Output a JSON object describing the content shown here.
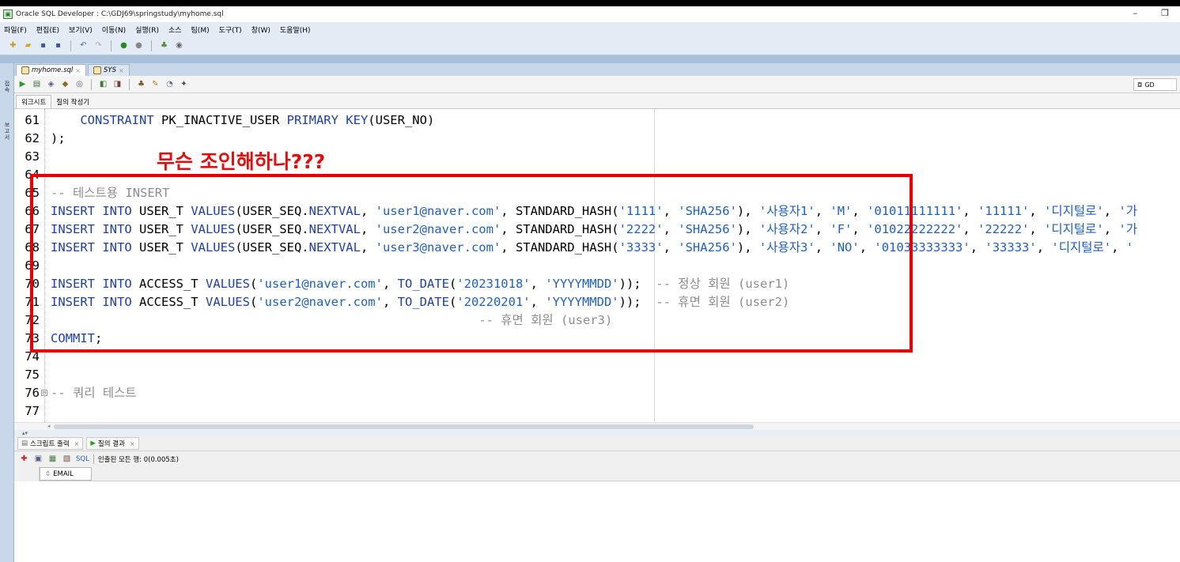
{
  "window": {
    "title": "Oracle SQL Developer : C:\\GDJ69\\springstudy\\myhome.sql",
    "minimize": "–",
    "restore": "❐"
  },
  "menu": [
    "파일(F)",
    "편집(E)",
    "보기(V)",
    "이동(N)",
    "실행(R)",
    "소스",
    "팀(M)",
    "도구(T)",
    "창(W)",
    "도움말(H)"
  ],
  "left_strip": {
    "tab1": "접속",
    "tab2": "보고서"
  },
  "doc_tabs": [
    {
      "label": "myhome.sql",
      "active": true
    },
    {
      "label": "SYS",
      "active": false
    }
  ],
  "editor_toolbar": {
    "connection": "GD"
  },
  "sub_tabs": [
    "워크시트",
    "질의 작성기"
  ],
  "code_lines": [
    {
      "num": "61",
      "segments": [
        {
          "t": "    ",
          "c": ""
        },
        {
          "t": "CONSTRAINT",
          "c": "kw"
        },
        {
          "t": " PK_INACTIVE_USER ",
          "c": ""
        },
        {
          "t": "PRIMARY KEY",
          "c": "kw"
        },
        {
          "t": "(USER_NO)",
          "c": ""
        }
      ]
    },
    {
      "num": "62",
      "segments": [
        {
          "t": ");",
          "c": ""
        }
      ]
    },
    {
      "num": "63",
      "segments": []
    },
    {
      "num": "64",
      "segments": []
    },
    {
      "num": "65",
      "segments": [
        {
          "t": "-- 테스트용 INSERT",
          "c": "cm"
        }
      ]
    },
    {
      "num": "66",
      "segments": [
        {
          "t": "INSERT INTO",
          "c": "kw"
        },
        {
          "t": " USER_T ",
          "c": ""
        },
        {
          "t": "VALUES",
          "c": "kw"
        },
        {
          "t": "(USER_SEQ.",
          "c": ""
        },
        {
          "t": "NEXTVAL",
          "c": "kw"
        },
        {
          "t": ", ",
          "c": ""
        },
        {
          "t": "'user1@naver.com'",
          "c": "str"
        },
        {
          "t": ", STANDARD_HASH(",
          "c": ""
        },
        {
          "t": "'1111'",
          "c": "str"
        },
        {
          "t": ", ",
          "c": ""
        },
        {
          "t": "'SHA256'",
          "c": "str"
        },
        {
          "t": "), ",
          "c": ""
        },
        {
          "t": "'사용자1'",
          "c": "str"
        },
        {
          "t": ", ",
          "c": ""
        },
        {
          "t": "'M'",
          "c": "str"
        },
        {
          "t": ", ",
          "c": ""
        },
        {
          "t": "'01011111111'",
          "c": "str"
        },
        {
          "t": ", ",
          "c": ""
        },
        {
          "t": "'11111'",
          "c": "str"
        },
        {
          "t": ", ",
          "c": ""
        },
        {
          "t": "'디지털로'",
          "c": "str"
        },
        {
          "t": ", ",
          "c": ""
        },
        {
          "t": "'가",
          "c": "str"
        }
      ]
    },
    {
      "num": "67",
      "segments": [
        {
          "t": "INSERT INTO",
          "c": "kw"
        },
        {
          "t": " USER_T ",
          "c": ""
        },
        {
          "t": "VALUES",
          "c": "kw"
        },
        {
          "t": "(USER_SEQ.",
          "c": ""
        },
        {
          "t": "NEXTVAL",
          "c": "kw"
        },
        {
          "t": ", ",
          "c": ""
        },
        {
          "t": "'user2@naver.com'",
          "c": "str"
        },
        {
          "t": ", STANDARD_HASH(",
          "c": ""
        },
        {
          "t": "'2222'",
          "c": "str"
        },
        {
          "t": ", ",
          "c": ""
        },
        {
          "t": "'SHA256'",
          "c": "str"
        },
        {
          "t": "), ",
          "c": ""
        },
        {
          "t": "'사용자2'",
          "c": "str"
        },
        {
          "t": ", ",
          "c": ""
        },
        {
          "t": "'F'",
          "c": "str"
        },
        {
          "t": ", ",
          "c": ""
        },
        {
          "t": "'01022222222'",
          "c": "str"
        },
        {
          "t": ", ",
          "c": ""
        },
        {
          "t": "'22222'",
          "c": "str"
        },
        {
          "t": ", ",
          "c": ""
        },
        {
          "t": "'디지털로'",
          "c": "str"
        },
        {
          "t": ", ",
          "c": ""
        },
        {
          "t": "'가",
          "c": "str"
        }
      ]
    },
    {
      "num": "68",
      "segments": [
        {
          "t": "INSERT INTO",
          "c": "kw"
        },
        {
          "t": " USER_T ",
          "c": ""
        },
        {
          "t": "VALUES",
          "c": "kw"
        },
        {
          "t": "(USER_SEQ.",
          "c": ""
        },
        {
          "t": "NEXTVAL",
          "c": "kw"
        },
        {
          "t": ", ",
          "c": ""
        },
        {
          "t": "'user3@naver.com'",
          "c": "str"
        },
        {
          "t": ", STANDARD_HASH(",
          "c": ""
        },
        {
          "t": "'3333'",
          "c": "str"
        },
        {
          "t": ", ",
          "c": ""
        },
        {
          "t": "'SHA256'",
          "c": "str"
        },
        {
          "t": "), ",
          "c": ""
        },
        {
          "t": "'사용자3'",
          "c": "str"
        },
        {
          "t": ", ",
          "c": ""
        },
        {
          "t": "'NO'",
          "c": "str"
        },
        {
          "t": ", ",
          "c": ""
        },
        {
          "t": "'01033333333'",
          "c": "str"
        },
        {
          "t": ", ",
          "c": ""
        },
        {
          "t": "'33333'",
          "c": "str"
        },
        {
          "t": ", ",
          "c": ""
        },
        {
          "t": "'디지털로'",
          "c": "str"
        },
        {
          "t": ", ",
          "c": ""
        },
        {
          "t": "'",
          "c": "str"
        }
      ]
    },
    {
      "num": "69",
      "segments": []
    },
    {
      "num": "70",
      "segments": [
        {
          "t": "INSERT INTO",
          "c": "kw"
        },
        {
          "t": " ACCESS_T ",
          "c": ""
        },
        {
          "t": "VALUES",
          "c": "kw"
        },
        {
          "t": "(",
          "c": ""
        },
        {
          "t": "'user1@naver.com'",
          "c": "str"
        },
        {
          "t": ", ",
          "c": ""
        },
        {
          "t": "TO_DATE",
          "c": "kw"
        },
        {
          "t": "(",
          "c": ""
        },
        {
          "t": "'20231018'",
          "c": "str"
        },
        {
          "t": ", ",
          "c": ""
        },
        {
          "t": "'YYYYMMDD'",
          "c": "str"
        },
        {
          "t": "));  ",
          "c": ""
        },
        {
          "t": "-- 정상 회원 (user1)",
          "c": "cm"
        }
      ]
    },
    {
      "num": "71",
      "segments": [
        {
          "t": "INSERT INTO",
          "c": "kw"
        },
        {
          "t": " ACCESS_T ",
          "c": ""
        },
        {
          "t": "VALUES",
          "c": "kw"
        },
        {
          "t": "(",
          "c": ""
        },
        {
          "t": "'user2@naver.com'",
          "c": "str"
        },
        {
          "t": ", ",
          "c": ""
        },
        {
          "t": "TO_DATE",
          "c": "kw"
        },
        {
          "t": "(",
          "c": ""
        },
        {
          "t": "'20220201'",
          "c": "str"
        },
        {
          "t": ", ",
          "c": ""
        },
        {
          "t": "'YYYYMMDD'",
          "c": "str"
        },
        {
          "t": "));  ",
          "c": ""
        },
        {
          "t": "-- 휴면 회원 (user2)",
          "c": "cm"
        }
      ]
    },
    {
      "num": "72",
      "segments": [
        {
          "t": "                                                          ",
          "c": ""
        },
        {
          "t": "-- 휴면 회원 (user3)",
          "c": "cm"
        }
      ]
    },
    {
      "num": "73",
      "segments": [
        {
          "t": "COMMIT",
          "c": "kw"
        },
        {
          "t": ";",
          "c": ""
        }
      ]
    },
    {
      "num": "74",
      "segments": []
    },
    {
      "num": "75",
      "segments": []
    },
    {
      "num": "76",
      "segments": [
        {
          "t": "-- 쿼리 테스트",
          "c": "cm"
        }
      ],
      "fold": "⊟"
    },
    {
      "num": "77",
      "segments": []
    }
  ],
  "annotation": {
    "text": "무슨 조인해하나???",
    "color": "#e60000"
  },
  "output_tabs": [
    "스크립트 출력",
    "질의 결과"
  ],
  "output_toolbar": {
    "sql": "SQL",
    "status": "인출된 모든 행: 0(0.005초)"
  },
  "result_columns": [
    "EMAIL"
  ]
}
